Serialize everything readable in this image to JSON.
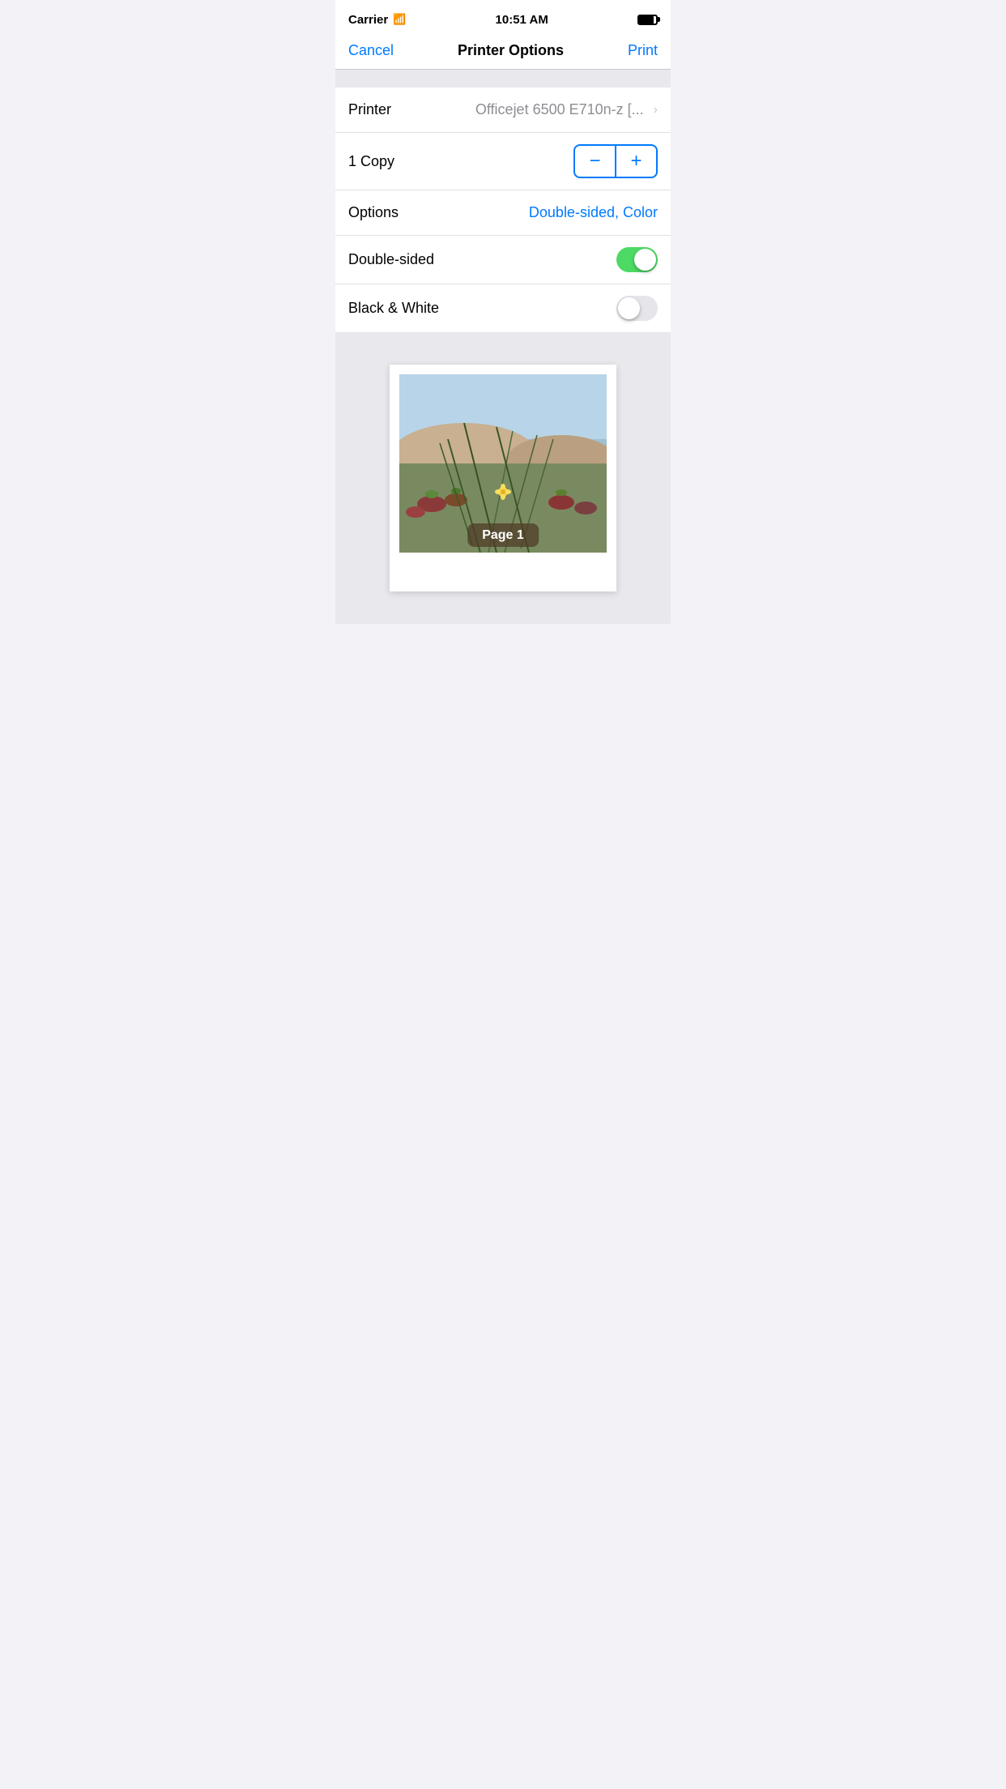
{
  "statusBar": {
    "carrier": "Carrier",
    "time": "10:51 AM"
  },
  "navBar": {
    "cancelLabel": "Cancel",
    "title": "Printer Options",
    "printLabel": "Print"
  },
  "printer": {
    "label": "Printer",
    "value": "Officejet 6500 E710n-z [..."
  },
  "copies": {
    "label": "1 Copy",
    "decrementLabel": "−",
    "incrementLabel": "+"
  },
  "options": {
    "label": "Options",
    "value": "Double-sided, Color"
  },
  "doubleSided": {
    "label": "Double-sided",
    "enabled": true
  },
  "blackAndWhite": {
    "label": "Black & White",
    "enabled": false
  },
  "preview": {
    "pageLabel": "Page 1"
  },
  "colors": {
    "blue": "#007aff",
    "green": "#4cd964",
    "lightGray": "#e5e5ea",
    "textGray": "#8e8e93"
  }
}
